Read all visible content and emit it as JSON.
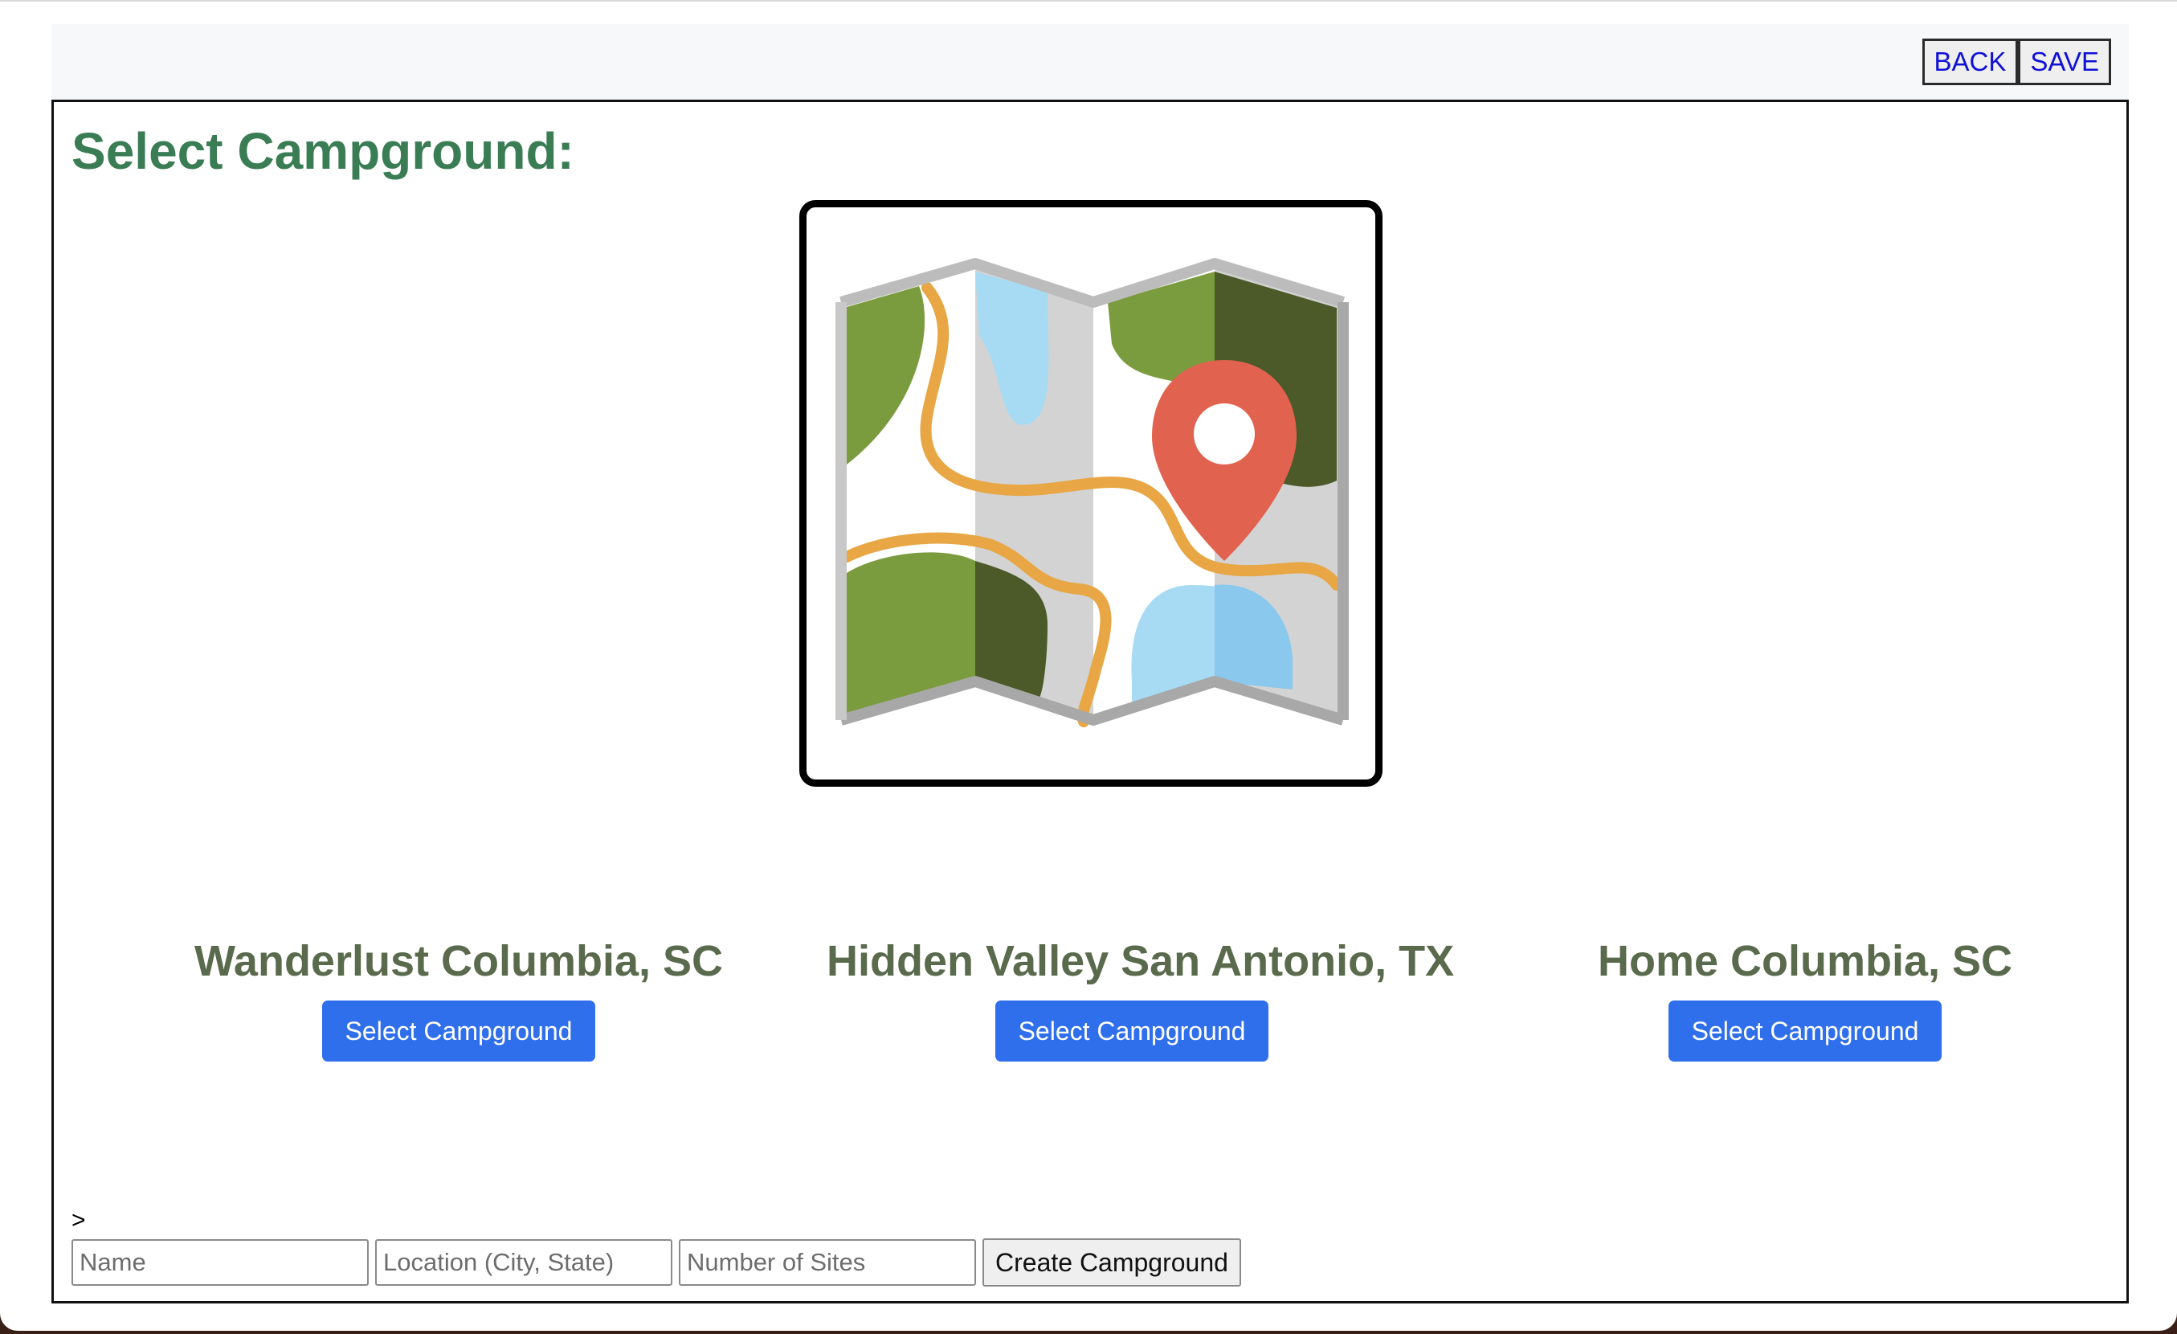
{
  "toolbar": {
    "back_label": "BACK",
    "save_label": "SAVE"
  },
  "page": {
    "title": "Select Campground:"
  },
  "campgrounds": [
    {
      "name": "Wanderlust Columbia, SC",
      "button_label": "Select Campground"
    },
    {
      "name": "Hidden Valley San Antonio, TX",
      "button_label": "Select Campground"
    },
    {
      "name": "Home Columbia, SC",
      "button_label": "Select Campground"
    }
  ],
  "create_form": {
    "prompt": ">",
    "name_placeholder": "Name",
    "location_placeholder": "Location (City, State)",
    "sites_placeholder": "Number of Sites",
    "submit_label": "Create Campground"
  },
  "colors": {
    "title_green": "#3a7d55",
    "camp_name": "#5a6a4d",
    "primary_button": "#2f6fec",
    "toolbar_link": "#1010d8"
  },
  "icons": {
    "hero": "folded-map-with-location-pin-icon"
  }
}
